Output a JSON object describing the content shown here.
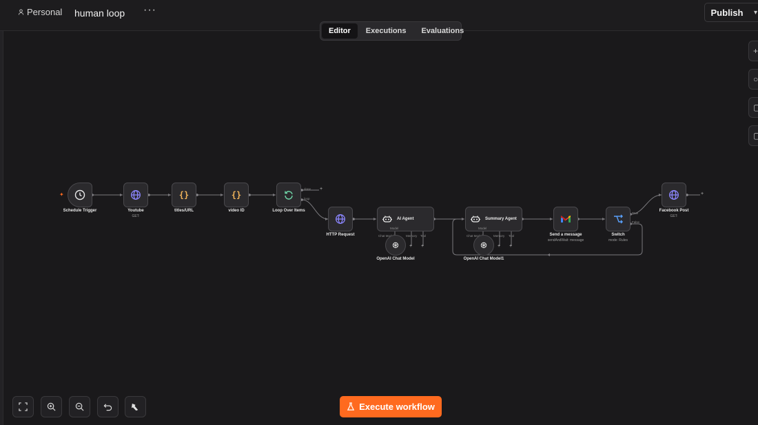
{
  "header": {
    "workspace": "Personal",
    "workflow_name": "human loop",
    "more": "···",
    "publish_label": "Publish"
  },
  "tabs": [
    {
      "label": "Editor",
      "active": true
    },
    {
      "label": "Executions",
      "active": false
    },
    {
      "label": "Evaluations",
      "active": false
    }
  ],
  "nodes": {
    "schedule": {
      "title": "Schedule Trigger"
    },
    "youtube": {
      "title": "Youtube",
      "sub": "GET:"
    },
    "titles": {
      "title": "titles/URL"
    },
    "video": {
      "title": "video ID"
    },
    "loop": {
      "title": "Loop Over Items",
      "port_done": "done",
      "port_loop": "loop"
    },
    "http": {
      "title": "HTTP Request"
    },
    "agent": {
      "title": "AI Agent",
      "port_model": "Model",
      "port_chat": "Chat Model",
      "port_memory": "Memory",
      "port_tool": "Tool"
    },
    "openai1": {
      "title": "OpenAI Chat Model"
    },
    "summary": {
      "title": "Summary Agent",
      "port_model": "Model",
      "port_chat": "Chat Model",
      "port_memory": "Memory",
      "port_tool": "Tool"
    },
    "openai2": {
      "title": "OpenAI Chat Model1"
    },
    "gmail": {
      "title": "Send a message",
      "sub": "sendAndWait: message"
    },
    "switch": {
      "title": "Switch",
      "sub": "mode: Rules",
      "port_true": "True",
      "port_false": "False"
    },
    "facebook": {
      "title": "Facebook Post",
      "sub": "GET:"
    }
  },
  "bottom": {
    "execute_label": "Execute workflow"
  },
  "colors": {
    "accent": "#ff6a1f",
    "http_icon": "#8c86ff",
    "code_icon": "#f0b35a",
    "loop_icon": "#6fd6a8"
  }
}
